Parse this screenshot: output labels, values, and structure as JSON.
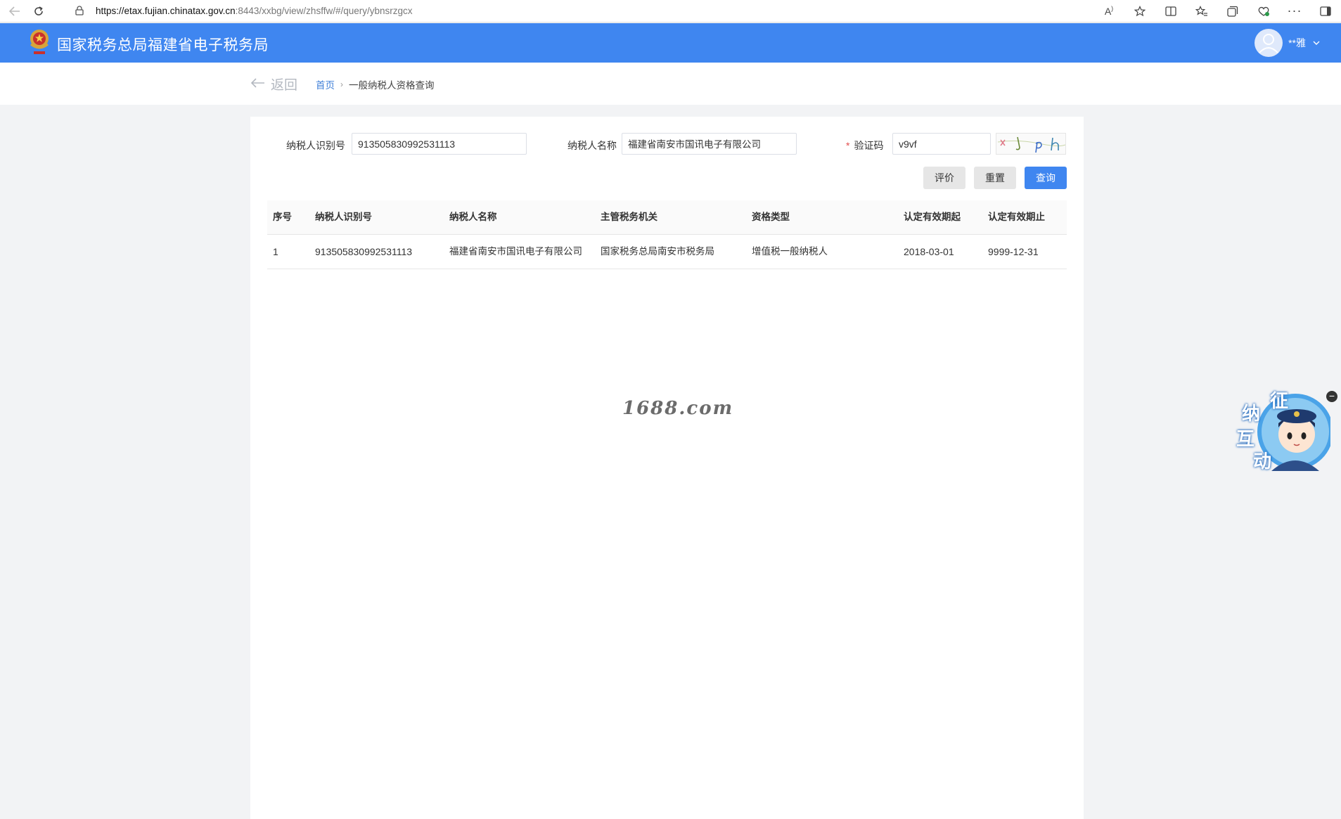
{
  "browser": {
    "url_host": "https://etax.fujian.chinatax.gov.cn",
    "url_path": ":8443/xxbg/view/zhsffw/#/query/ybnsrzgcx",
    "read_aloud_icon": "A",
    "icons": [
      "back-icon",
      "refresh-icon",
      "lock-icon",
      "read-aloud-icon",
      "star-icon",
      "split-screen-icon",
      "favorites-icon",
      "collections-icon",
      "browser-essentials-icon",
      "more-icon",
      "sidebar-icon"
    ]
  },
  "header": {
    "title": "国家税务总局福建省电子税务局",
    "user_name": "**雅",
    "bg_color": "#3f86f0"
  },
  "breadcrumb": {
    "back_label": "返回",
    "home_label": "首页",
    "current_label": "一般纳税人资格查询"
  },
  "form": {
    "taxpayer_id_label": "纳税人识别号",
    "taxpayer_id_value": "913505830992531113",
    "taxpayer_name_label": "纳税人名称",
    "taxpayer_name_value": "福建省南安市国讯电子有限公司",
    "captcha_required_mark": "*",
    "captcha_label": "验证码",
    "captcha_value": "v9vf"
  },
  "buttons": {
    "evaluate": "评价",
    "reset": "重置",
    "query": "查询"
  },
  "table": {
    "headers": [
      "序号",
      "纳税人识别号",
      "纳税人名称",
      "主管税务机关",
      "资格类型",
      "认定有效期起",
      "认定有效期止"
    ],
    "rows": [
      [
        "1",
        "913505830992531113",
        "福建省南安市国讯电子有限公司",
        "国家税务总局南安市税务局",
        "增值税一般纳税人",
        "2018-03-01",
        "9999-12-31"
      ]
    ]
  },
  "watermark": "1688.com",
  "float_widget": {
    "chars": [
      "征",
      "纳",
      "互",
      "动"
    ],
    "close_glyph": "−"
  }
}
